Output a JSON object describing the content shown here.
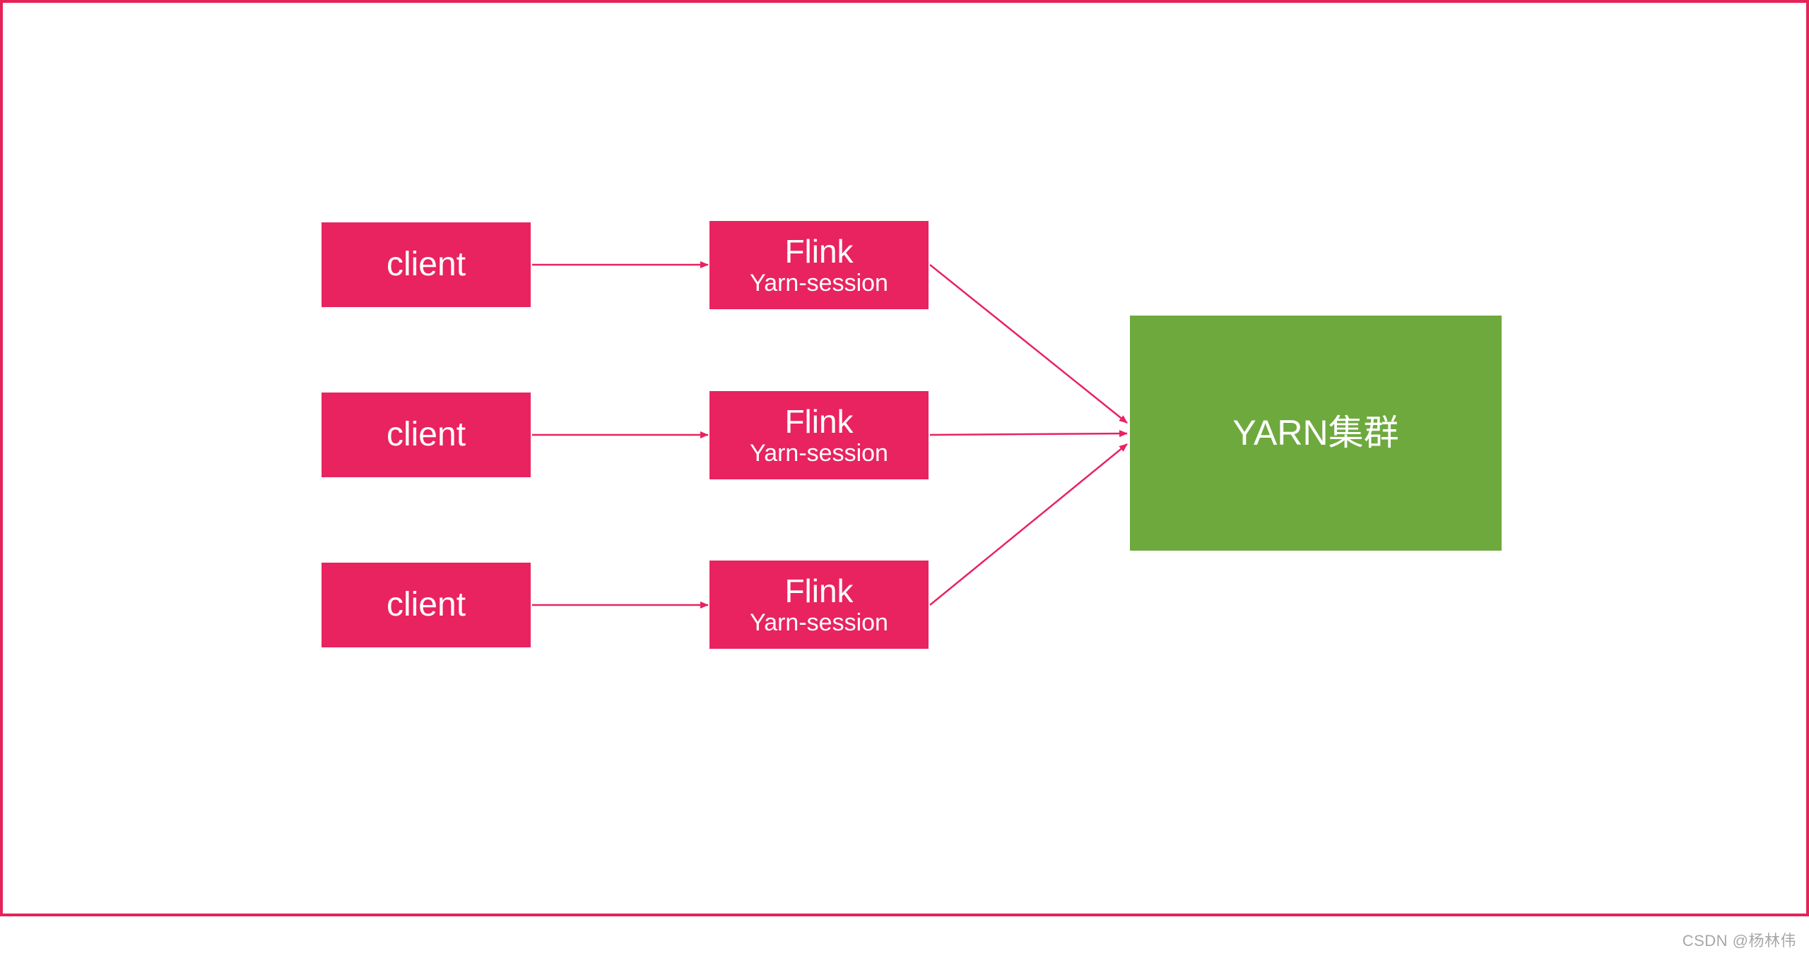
{
  "diagram": {
    "clients": [
      {
        "label": "client"
      },
      {
        "label": "client"
      },
      {
        "label": "client"
      }
    ],
    "flink_nodes": [
      {
        "title": "Flink",
        "subtitle": "Yarn-session"
      },
      {
        "title": "Flink",
        "subtitle": "Yarn-session"
      },
      {
        "title": "Flink",
        "subtitle": "Yarn-session"
      }
    ],
    "cluster": {
      "label": "YARN集群"
    },
    "colors": {
      "pink": "#E82360",
      "green": "#6EA93E",
      "border": "#E52359"
    }
  },
  "watermark": "CSDN @杨林伟"
}
